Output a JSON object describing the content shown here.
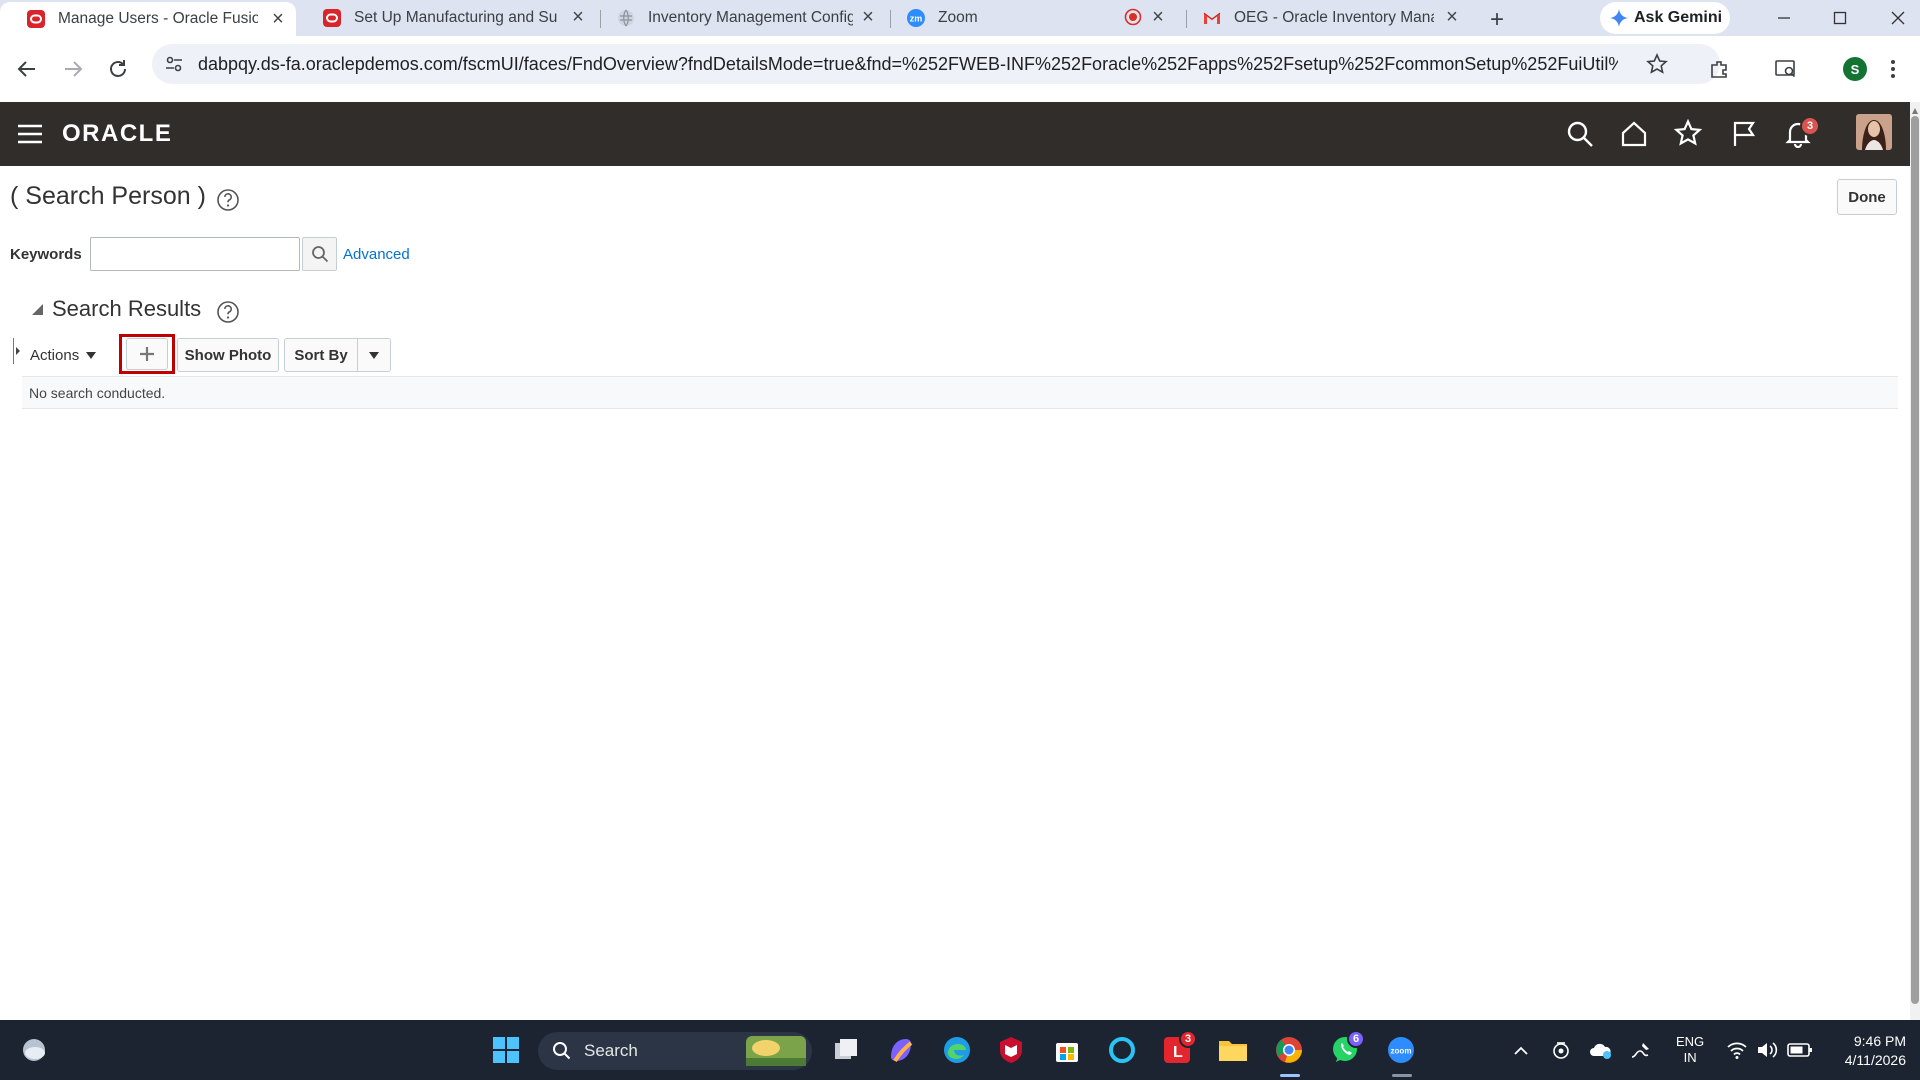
{
  "browser": {
    "tabs": [
      {
        "title": "Manage Users - Oracle Fusion",
        "active": true
      },
      {
        "title": "Set Up Manufacturing and Su"
      },
      {
        "title": "Inventory Management Config"
      },
      {
        "title": "Zoom"
      },
      {
        "title": "OEG - Oracle Inventory Manag"
      }
    ],
    "new_tab_symbol": "+",
    "ask_gemini": "Ask Gemini",
    "url": "dabpqy.ds-fa.oraclepdemos.com/fscmUI/faces/FndOverview?fndDetailsMode=true&fnd=%252FWEB-INF%252Foracle%252Fapps%252Fsetup%252FcommonSetup%252FuiUtil%252F...",
    "profile_initial": "S"
  },
  "oracle": {
    "logo": "ORACLE",
    "notification_count": "3"
  },
  "page": {
    "title": "( Search Person )",
    "done_label": "Done",
    "keywords_label": "Keywords",
    "keywords_value": "",
    "advanced_link": "Advanced",
    "results_title": "Search Results",
    "actions_label": "Actions",
    "show_photo_label": "Show Photo",
    "sort_by_label": "Sort By",
    "empty_message": "No search conducted."
  },
  "taskbar": {
    "search_placeholder": "Search",
    "lightroom_badge": "3",
    "whatsapp_badge": "6",
    "language": "ENG",
    "region": "IN",
    "time": "9:46 PM",
    "date": "4/11/2026"
  },
  "colors": {
    "oracle_header": "#312d2a",
    "link": "#0572ce",
    "highlight_box": "#c00000",
    "tabstrip": "#dde3f0",
    "taskbar": "#1c2431"
  }
}
